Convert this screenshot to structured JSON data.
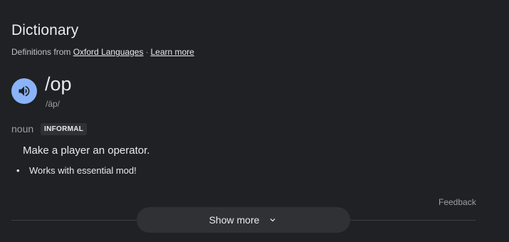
{
  "header": {
    "title": "Dictionary",
    "source_prefix": "Definitions from",
    "source_link": "Oxford Languages",
    "separator": "·",
    "learn_more": "Learn more"
  },
  "entry": {
    "word": "/op",
    "phonetic": "/äp/",
    "part_of_speech": "noun",
    "register_label": "INFORMAL",
    "definition": "Make a player an operator.",
    "example": "Works with essential mod!"
  },
  "footer": {
    "feedback": "Feedback",
    "show_more": "Show more"
  },
  "icons": {
    "speaker": "speaker-icon",
    "show_more": "chevron-down-icon"
  },
  "colors": {
    "background": "#202124",
    "accent": "#8ab4f8",
    "badge_bg": "#303134"
  }
}
